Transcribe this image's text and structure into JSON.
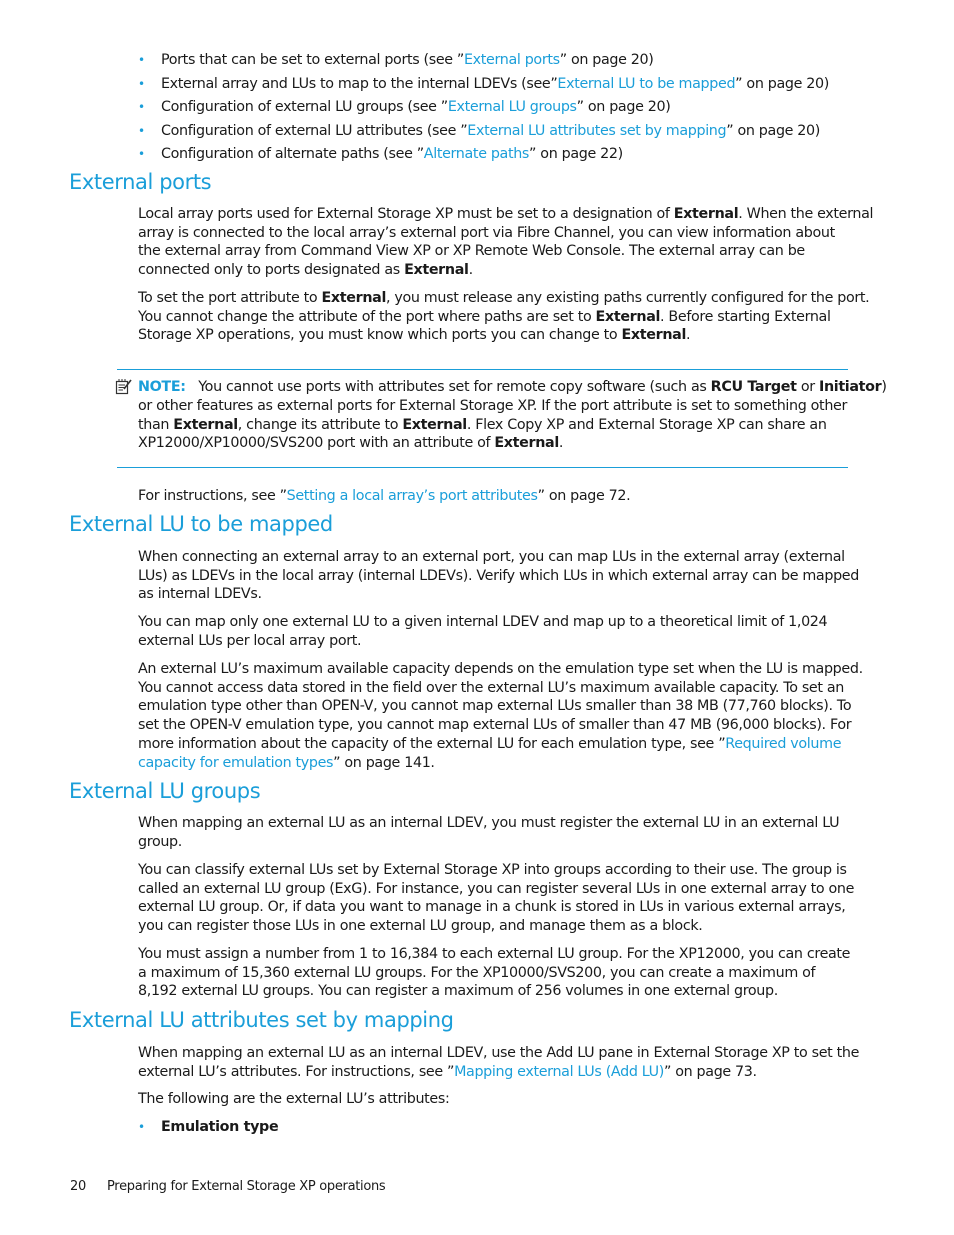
{
  "intro_bullets": [
    {
      "before": "Ports that can be set to external ports (see ”",
      "link": "External ports",
      "after": "” on page 20)"
    },
    {
      "before": "External array and LUs to map to the internal LDEVs (see”",
      "link": "External LU to be mapped",
      "after": "” on page 20)"
    },
    {
      "before": "Configuration of external LU groups (see ”",
      "link": "External LU groups",
      "after": "” on page 20)"
    },
    {
      "before": "Configuration of external LU attributes (see ”",
      "link": "External LU attributes set by mapping",
      "after": "” on page 20)"
    },
    {
      "before": "Configuration of alternate paths (see ”",
      "link": "Alternate paths",
      "after": "” on page 22)"
    }
  ],
  "bullet_glyph": "•",
  "sections": {
    "external_ports": {
      "heading": "External ports",
      "p1": {
        "l1a": "Local array ports used for External Storage XP must be set to a designation of ",
        "l1b": "External",
        "l1c": ". When the external",
        "l2": "array is connected to the local array’s external port via Fibre Channel, you can view information about",
        "l3": "the external array from Command View XP or XP Remote Web Console. The external array can be",
        "l4a": "connected only to ports designated as ",
        "l4b": "External",
        "l4c": "."
      },
      "p2": {
        "l1a": "To set the port attribute to ",
        "l1b": "External",
        "l1c": ", you must release any existing paths currently configured for the port.",
        "l2a": "You cannot change the attribute of the port where paths are set to ",
        "l2b": "External",
        "l2c": ". Before starting External",
        "l3a": "Storage XP operations, you must know which ports you can change to ",
        "l3b": "External",
        "l3c": "."
      },
      "note": {
        "icon": "note-icon",
        "label": "NOTE:",
        "l1a": "   You cannot use ports with attributes set for remote copy software (such as ",
        "l1b": "RCU Target",
        "l1c": " or ",
        "l1d": "Initiator",
        "l1e": ")",
        "l2": "or other features as external ports for External Storage XP. If the port attribute is set to something other",
        "l3a": "than ",
        "l3b": "External",
        "l3c": ", change its attribute to ",
        "l3d": "External",
        "l3e": ". Flex Copy XP and External Storage XP can share an",
        "l4a": "XP12000/XP10000/SVS200 port with an attribute of ",
        "l4b": "External",
        "l4c": "."
      },
      "instructions": {
        "before": "For instructions, see ”",
        "link": "Setting a local array’s port attributes",
        "after": "” on page 72."
      }
    },
    "external_lu_mapped": {
      "heading": "External LU to be mapped",
      "p1": [
        "When connecting an external array to an external port, you can map LUs in the external array (external",
        "LUs) as LDEVs in the local array (internal LDEVs). Verify which LUs in which external array can be mapped",
        "as internal LDEVs."
      ],
      "p2": [
        "You can map only one external LU to a given internal LDEV and map up to a theoretical limit of 1,024",
        "external LUs per local array port."
      ],
      "p3": {
        "l1": "An external LU’s maximum available capacity depends on the emulation type set when the LU is mapped.",
        "l2": "You cannot access data stored in the field over the external LU’s maximum available capacity. To set an",
        "l3": "emulation type other than OPEN-V, you cannot map external LUs smaller than 38 MB (77,760 blocks). To",
        "l4": "set the OPEN-V emulation type, you cannot map external LUs of smaller than 47 MB (96,000 blocks). For",
        "l5a": "more information about the capacity of the external LU for each emulation type, see ”",
        "l5link": "Required volume",
        "l6link": "capacity for emulation types",
        "l6after": "” on page 141."
      }
    },
    "external_lu_groups": {
      "heading": "External LU groups",
      "p1": [
        "When mapping an external LU as an internal LDEV, you must register the external LU in an external LU",
        "group."
      ],
      "p2": [
        "You can classify external LUs set by External Storage XP into groups according to their use. The group is",
        "called an external LU group (ExG). For instance, you can register several LUs in one external array to one",
        "external LU group. Or, if data you want to manage in a chunk is stored in LUs in various external arrays,",
        "you can register those LUs in one external LU group, and manage them as a block."
      ],
      "p3": [
        "You must assign a number from 1 to 16,384 to each external LU group. For the XP12000, you can create",
        "a maximum of 15,360 external LU groups. For the XP10000/SVS200, you can create a maximum of",
        "8,192 external LU groups. You can register a maximum of 256 volumes in one external group."
      ]
    },
    "external_lu_attributes": {
      "heading": "External LU attributes set by mapping",
      "p1": {
        "l1": "When mapping an external LU as an internal LDEV, use the Add LU pane in External Storage XP to set the",
        "l2a": "external LU’s attributes. For instructions, see ”",
        "l2link": "Mapping external LUs (Add LU)",
        "l2after": "” on page 73."
      },
      "p2": "The following are the external LU’s attributes:",
      "bullet": "Emulation type"
    }
  },
  "footer": {
    "page_number": "20",
    "chapter_title": "Preparing for External Storage XP operations"
  },
  "colors": {
    "accent": "#1a9ed9",
    "text": "#1a1a1a"
  }
}
